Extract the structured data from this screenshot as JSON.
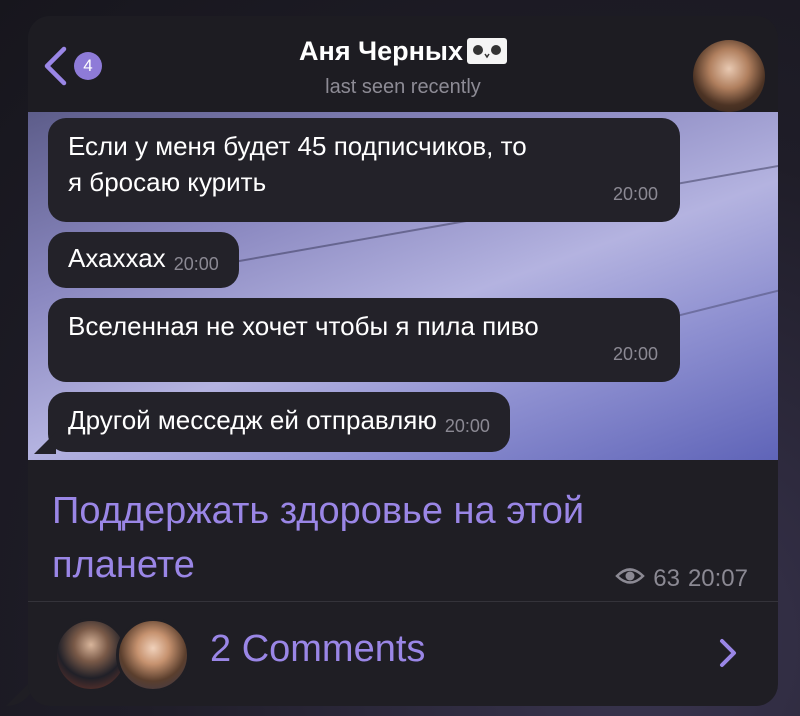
{
  "header": {
    "back_badge": "4",
    "name": "Аня Черных",
    "status": "last seen recently"
  },
  "messages": [
    {
      "text_line1": "Если у меня будет 45 подписчиков, то",
      "text_line2": "я бросаю курить",
      "time": "20:00"
    },
    {
      "text": "Ахаххах",
      "time": "20:00"
    },
    {
      "text": "Вселенная не хочет чтобы я пила пиво",
      "time": "20:00"
    },
    {
      "text": "Другой месседж ей отправляю",
      "time": "20:00"
    }
  ],
  "post": {
    "caption_line1": "Поддержать здоровье на этой",
    "caption_line2": "планете",
    "views": "63",
    "time": "20:07"
  },
  "comments": {
    "label": "2 Comments"
  },
  "colors": {
    "accent": "#9a86e6",
    "bubble": "#232229",
    "badge": "#8e7bd8"
  },
  "icons": [
    "back-chevron-icon",
    "eye-icon",
    "chevron-right-icon"
  ]
}
